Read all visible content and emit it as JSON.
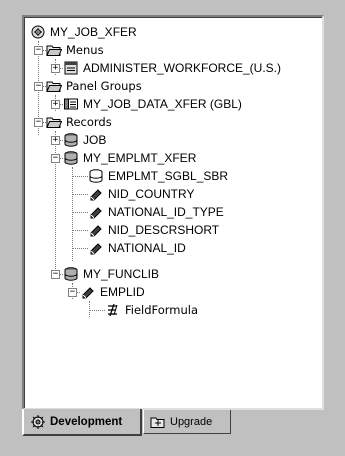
{
  "tree": {
    "root": "MY_JOB_XFER",
    "menus": "Menus",
    "administer_workforce": "ADMINISTER_WORKFORCE_(U.S.)",
    "panel_groups": "Panel Groups",
    "my_job_data_xfer": "MY_JOB_DATA_XFER (GBL)",
    "records": "Records",
    "job": "JOB",
    "my_emplmt_xfer": "MY_EMPLMT_XFER",
    "emplmt_sgbl_sbr": "EMPLMT_SGBL_SBR",
    "nid_country": "NID_COUNTRY",
    "national_id_type": "NATIONAL_ID_TYPE",
    "nid_descrshort": "NID_DESCRSHORT",
    "national_id": "NATIONAL_ID",
    "my_funclib": "MY_FUNCLIB",
    "emplid": "EMPLID",
    "field_formula": "FieldFormula"
  },
  "tabs": {
    "development": "Development",
    "upgrade": "Upgrade"
  },
  "icons": {
    "project": "project-icon",
    "folder": "folder-open-icon",
    "menu": "menu-icon",
    "panel_group": "panel-group-icon",
    "record": "record-icon",
    "field": "field-icon",
    "peoplecode": "peoplecode-icon"
  }
}
